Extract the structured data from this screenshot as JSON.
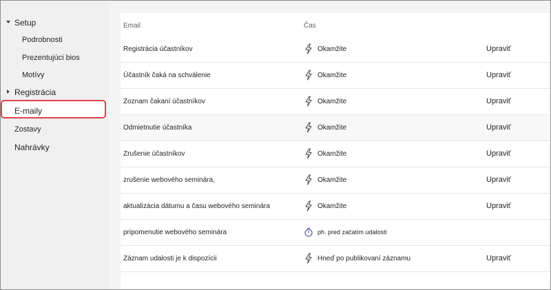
{
  "sidebar": {
    "setup": "Setup",
    "setup_children": [
      "Podrobnosti",
      "Prezentujúci bios",
      "Motívy"
    ],
    "registration": "Registrácia",
    "emails": "E-maily",
    "reports": "Zostavy",
    "recordings": "Nahrávky"
  },
  "table": {
    "headers": {
      "email": "Email",
      "time": "Čas"
    },
    "rows": [
      {
        "email": "Registrácia účastníkov",
        "icon": "lightning-icon",
        "time": "Okamžite",
        "edit": "Upraviť"
      },
      {
        "email": "Účastník čaká na schválenie",
        "icon": "lightning-icon",
        "time": "Okamžite",
        "edit": "Upraviť"
      },
      {
        "email": "Zoznam čakaní účastníkov",
        "icon": "lightning-icon",
        "time": "Okamžite",
        "edit": "Upraviť"
      },
      {
        "email": "Odmietnutie účastníka",
        "icon": "lightning-icon",
        "time": "Okamžite",
        "edit": "Upraviť"
      },
      {
        "email": "Zrušenie účastníkov",
        "icon": "lightning-icon",
        "time": "Okamžite",
        "edit": "Upraviť"
      },
      {
        "email": "zrušenie webového seminára,",
        "icon": "lightning-icon",
        "time": "Okamžite",
        "edit": "Upraviť"
      },
      {
        "email": "aktualizácia dátumu a času webového seminára",
        "icon": "lightning-icon",
        "time": "Okamžite",
        "edit": "Upraviť"
      },
      {
        "email": "pripomenutie webového seminára",
        "icon": "timer-icon",
        "time": "ph. pred začatím udalosti",
        "edit": ""
      },
      {
        "email": "Záznam udalosti je k dispozícii",
        "icon": "lightning-icon",
        "time": "Hneď po publikovaní záznamu",
        "edit": "Upraviť"
      }
    ]
  },
  "colors": {
    "accent_highlight": "#e0414f",
    "sidebar_bg": "#f0f0f0",
    "timer_icon": "#6264a7"
  }
}
